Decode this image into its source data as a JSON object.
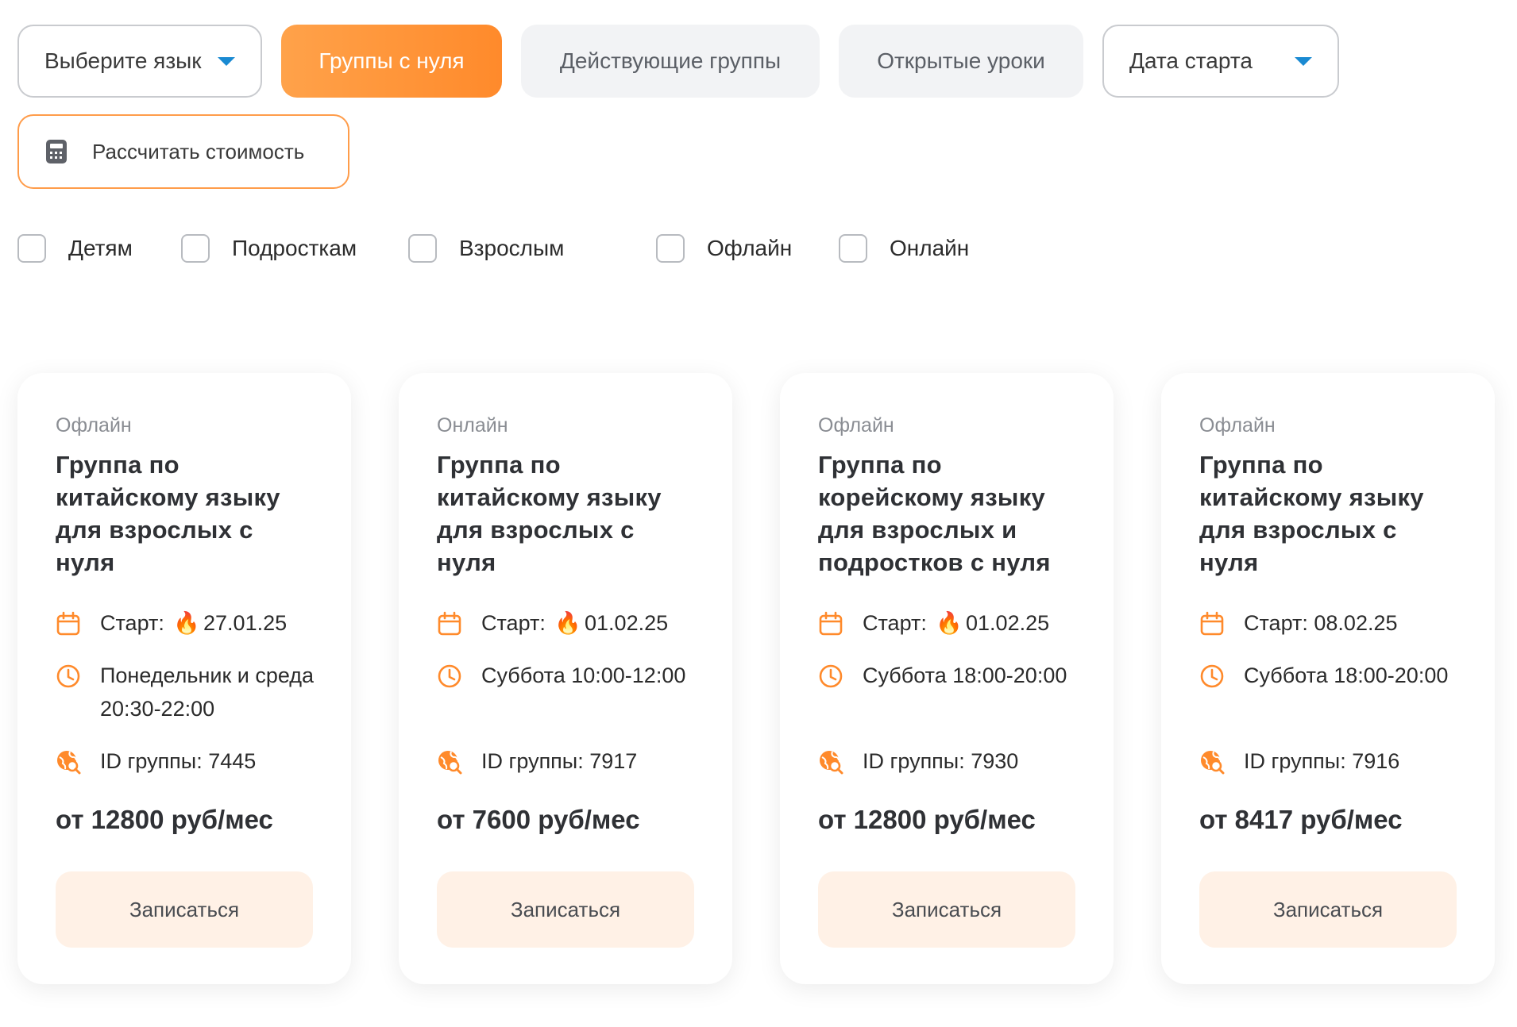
{
  "filters": {
    "language_select": "Выберите язык",
    "tabs": [
      "Группы с нуля",
      "Действующие группы",
      "Открытые уроки"
    ],
    "date_select": "Дата старта",
    "calc_button": "Рассчитать стоимость",
    "checkboxes": [
      "Детям",
      "Подросткам",
      "Взрослым",
      "Офлайн",
      "Онлайн"
    ]
  },
  "colors": {
    "accent": "#ff8a2b",
    "icon": "#ff8a2b",
    "caret": "#1a8ad2"
  },
  "fire_icon": "🔥",
  "cards": [
    {
      "format": "Офлайн",
      "title": "Группа по китайскому языку для взрослых с нуля",
      "start_label": "Старт:",
      "start_date": "27.01.25",
      "hot": true,
      "schedule": "Понедельник и среда 20:30-22:00",
      "group_id": "ID группы: 7445",
      "price": "от 12800 руб/мес",
      "button": "Записаться"
    },
    {
      "format": "Онлайн",
      "title": "Группа по китайскому языку для взрослых с нуля",
      "start_label": "Старт:",
      "start_date": "01.02.25",
      "hot": true,
      "schedule": "Суббота 10:00-12:00",
      "group_id": "ID группы: 7917",
      "price": "от 7600 руб/мес",
      "button": "Записаться"
    },
    {
      "format": "Офлайн",
      "title": "Группа по корейскому языку для взрослых и подростков с нуля",
      "start_label": "Старт:",
      "start_date": "01.02.25",
      "hot": true,
      "schedule": "Суббота 18:00-20:00",
      "group_id": "ID группы: 7930",
      "price": "от 12800 руб/мес",
      "button": "Записаться"
    },
    {
      "format": "Офлайн",
      "title": "Группа по китайскому языку для взрослых с нуля",
      "start_label": "Старт:",
      "start_date": "08.02.25",
      "hot": false,
      "schedule": "Суббота 18:00-20:00",
      "group_id": "ID группы: 7916",
      "price": "от 8417 руб/мес",
      "button": "Записаться"
    }
  ]
}
